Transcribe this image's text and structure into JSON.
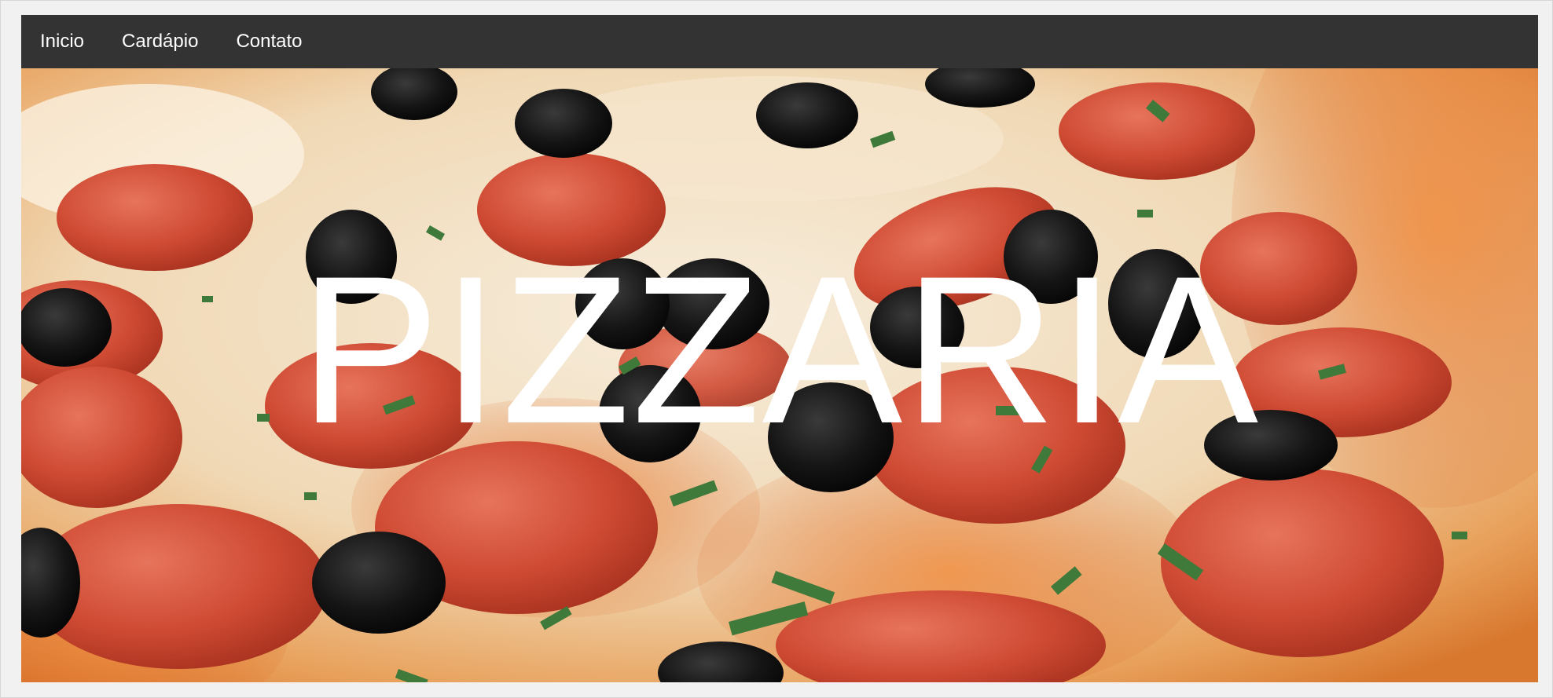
{
  "nav": {
    "items": [
      {
        "label": "Inicio"
      },
      {
        "label": "Cardápio"
      },
      {
        "label": "Contato"
      }
    ]
  },
  "hero": {
    "title": "PIZZARIA",
    "image": "pizza-photo",
    "colors": {
      "navbar_bg": "#333333",
      "title_color": "#ffffff",
      "cheese": "#f3e6d2",
      "pepperoni": "#c8432e",
      "olive": "#141414",
      "herb": "#3f7a3a"
    }
  }
}
